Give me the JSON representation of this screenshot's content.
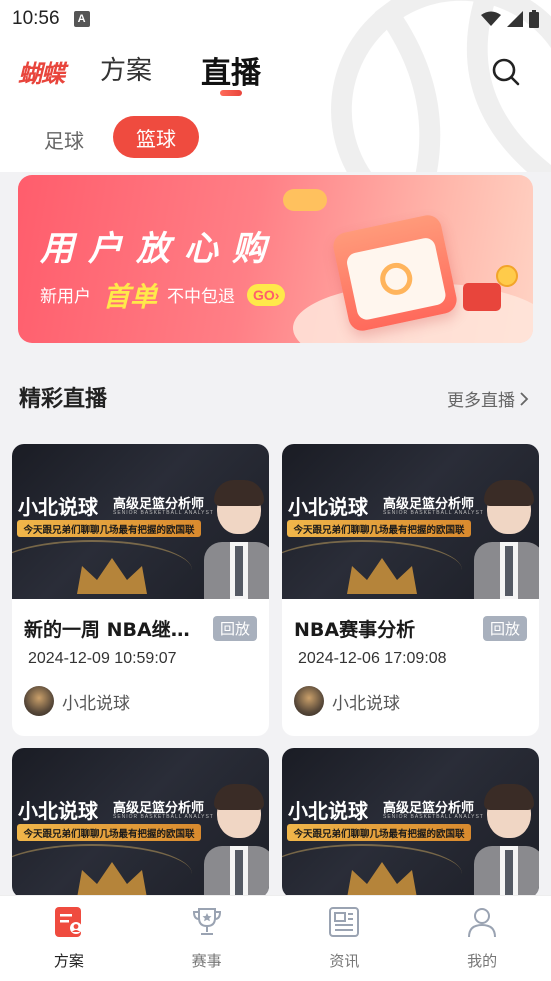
{
  "status_bar": {
    "time": "10:56",
    "notif_icon": "A"
  },
  "header": {
    "logo": "蝴蝶",
    "tabs": [
      {
        "label": "方案",
        "active": false
      },
      {
        "label": "直播",
        "active": true
      }
    ]
  },
  "sub_tabs": [
    {
      "label": "足球",
      "active": false
    },
    {
      "label": "篮球",
      "active": true
    }
  ],
  "banner": {
    "title": "用户放心购",
    "line_prefix": "新用户",
    "line_highlight": "首单",
    "line_suffix": "不中包退",
    "go_label": "GO"
  },
  "section": {
    "title": "精彩直播",
    "more_label": "更多直播"
  },
  "thumbnail": {
    "name": "小北说球",
    "role": "高级足篮分析师",
    "role_en": "SENIOR BASKETBALL ANALYST",
    "ribbon": "今天跟兄弟们聊聊几场最有把握的欧国联"
  },
  "cards": [
    {
      "title": "新的一周 NBA继续开赛",
      "badge": "回放",
      "time": "2024-12-09 10:59:07",
      "author": "小北说球"
    },
    {
      "title": "NBA赛事分析",
      "badge": "回放",
      "time": "2024-12-06 17:09:08",
      "author": "小北说球"
    },
    {
      "title": "",
      "badge": "",
      "time": "",
      "author": ""
    },
    {
      "title": "",
      "badge": "",
      "time": "",
      "author": ""
    }
  ],
  "bottom_nav": [
    {
      "label": "方案",
      "icon": "plan-icon",
      "active": true
    },
    {
      "label": "赛事",
      "icon": "trophy-icon",
      "active": false
    },
    {
      "label": "资讯",
      "icon": "news-icon",
      "active": false
    },
    {
      "label": "我的",
      "icon": "user-icon",
      "active": false
    }
  ],
  "colors": {
    "accent": "#ef4b3f",
    "replay_badge": "#a8b0bd"
  }
}
